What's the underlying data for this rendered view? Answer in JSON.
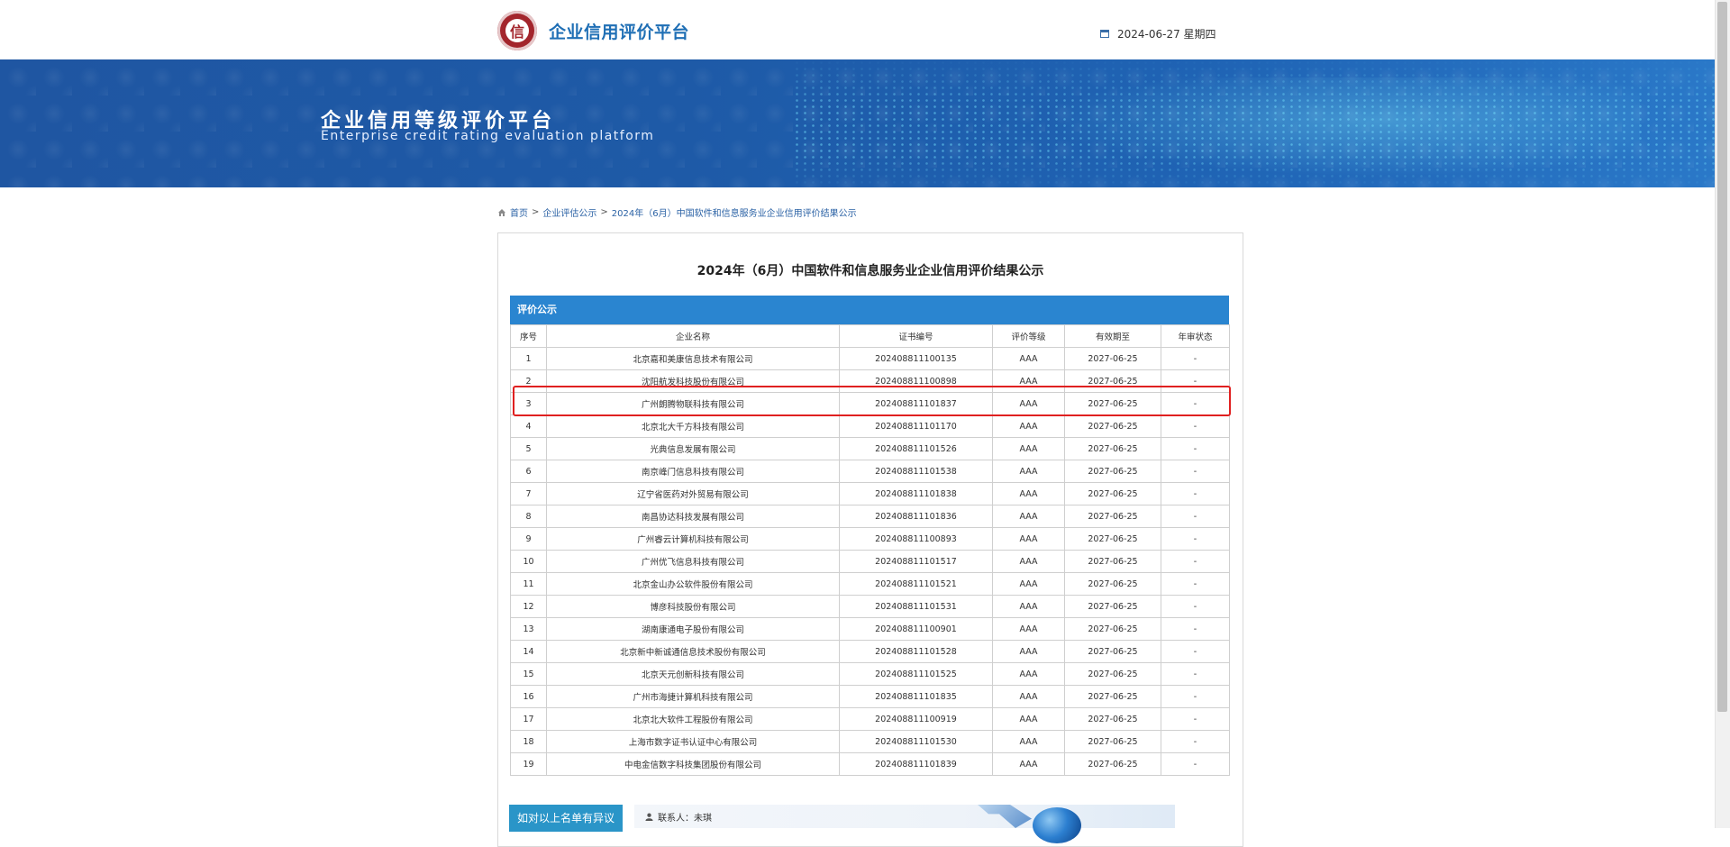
{
  "header": {
    "site_title": "企业信用评价平台",
    "logo_char": "信",
    "date": "2024-06-27 星期四",
    "date_icon": "calendar-icon"
  },
  "banner": {
    "title": "企业信用等级评价平台",
    "subtitle": "Enterprise credit rating evaluation platform"
  },
  "breadcrumb": {
    "home_icon": "home-icon",
    "items": [
      "首页",
      "企业评估公示",
      "2024年（6月）中国软件和信息服务业企业信用评价结果公示"
    ],
    "separator": ">"
  },
  "main": {
    "title": "2024年（6月）中国软件和信息服务业企业信用评价结果公示",
    "section_label": "评价公示",
    "columns": [
      "序号",
      "企业名称",
      "证书编号",
      "评价等级",
      "有效期至",
      "年审状态"
    ],
    "rows": [
      [
        "1",
        "北京嘉和美康信息技术有限公司",
        "202408811100135",
        "AAA",
        "2027-06-25",
        "-"
      ],
      [
        "2",
        "沈阳航发科技股份有限公司",
        "202408811100898",
        "AAA",
        "2027-06-25",
        "-"
      ],
      [
        "3",
        "广州朗腾物联科技有限公司",
        "202408811101837",
        "AAA",
        "2027-06-25",
        "-"
      ],
      [
        "4",
        "北京北大千方科技有限公司",
        "202408811101170",
        "AAA",
        "2027-06-25",
        "-"
      ],
      [
        "5",
        "光典信息发展有限公司",
        "202408811101526",
        "AAA",
        "2027-06-25",
        "-"
      ],
      [
        "6",
        "南京峰门信息科技有限公司",
        "202408811101538",
        "AAA",
        "2027-06-25",
        "-"
      ],
      [
        "7",
        "辽宁省医药对外贸易有限公司",
        "202408811101838",
        "AAA",
        "2027-06-25",
        "-"
      ],
      [
        "8",
        "南昌协达科技发展有限公司",
        "202408811101836",
        "AAA",
        "2027-06-25",
        "-"
      ],
      [
        "9",
        "广州睿云计算机科技有限公司",
        "202408811100893",
        "AAA",
        "2027-06-25",
        "-"
      ],
      [
        "10",
        "广州优飞信息科技有限公司",
        "202408811101517",
        "AAA",
        "2027-06-25",
        "-"
      ],
      [
        "11",
        "北京金山办公软件股份有限公司",
        "202408811101521",
        "AAA",
        "2027-06-25",
        "-"
      ],
      [
        "12",
        "博彦科技股份有限公司",
        "202408811101531",
        "AAA",
        "2027-06-25",
        "-"
      ],
      [
        "13",
        "湖南康通电子股份有限公司",
        "202408811100901",
        "AAA",
        "2027-06-25",
        "-"
      ],
      [
        "14",
        "北京新中新诚通信息技术股份有限公司",
        "202408811101528",
        "AAA",
        "2027-06-25",
        "-"
      ],
      [
        "15",
        "北京天元创新科技有限公司",
        "202408811101525",
        "AAA",
        "2027-06-25",
        "-"
      ],
      [
        "16",
        "广州市海捷计算机科技有限公司",
        "202408811101835",
        "AAA",
        "2027-06-25",
        "-"
      ],
      [
        "17",
        "北京北大软件工程股份有限公司",
        "202408811100919",
        "AAA",
        "2027-06-25",
        "-"
      ],
      [
        "18",
        "上海市数字证书认证中心有限公司",
        "202408811101530",
        "AAA",
        "2027-06-25",
        "-"
      ],
      [
        "19",
        "中电金信数字科技集团股份有限公司",
        "202408811101839",
        "AAA",
        "2027-06-25",
        "-"
      ]
    ],
    "highlighted_row": 3
  },
  "bottom": {
    "objection_text": "如对以上名单有异议",
    "contact_label": "联系人：未琪",
    "user_icon": "user-icon"
  },
  "colors": {
    "accent": "#2a85d0",
    "brand_blue": "#1f6fb5",
    "banner_blue": "#1e5aa7",
    "highlight_red": "#e02020",
    "logo_red": "#a3252c"
  }
}
